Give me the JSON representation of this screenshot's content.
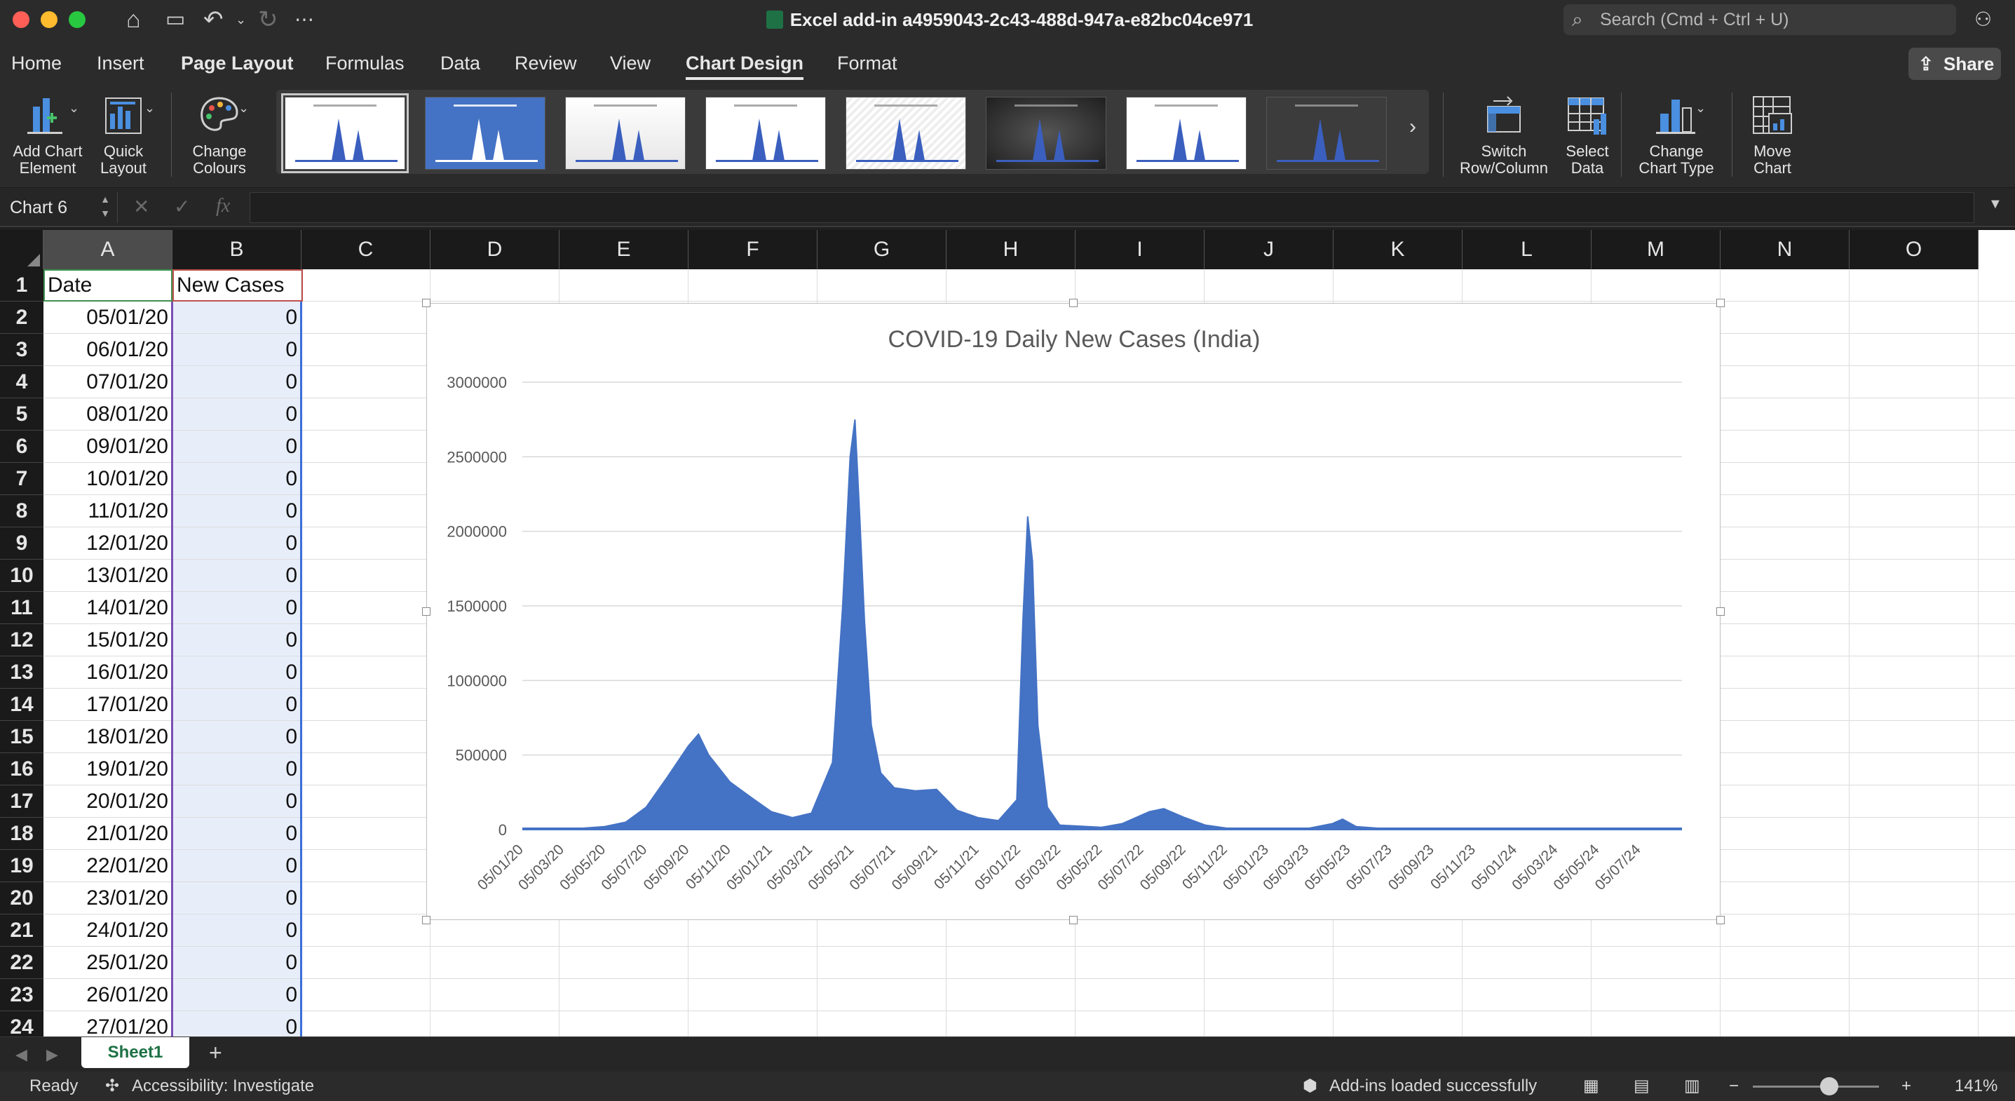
{
  "window": {
    "title": "Excel add-in a4959043-2c43-488d-947a-e82bc04ce971",
    "search_placeholder": "Search (Cmd + Ctrl + U)"
  },
  "menu": {
    "tabs": [
      "Home",
      "Insert",
      "Page Layout",
      "Formulas",
      "Data",
      "Review",
      "View",
      "Chart Design",
      "Format"
    ],
    "active": "Chart Design",
    "share_label": "Share"
  },
  "ribbon": {
    "add_chart_element": "Add Chart\nElement",
    "quick_layout": "Quick\nLayout",
    "change_colours": "Change\nColours",
    "switch_row_column": "Switch\nRow/Column",
    "select_data": "Select\nData",
    "change_chart_type": "Change\nChart Type",
    "move_chart": "Move\nChart"
  },
  "formula_bar": {
    "name_box": "Chart 6",
    "fx": "fx",
    "value": ""
  },
  "grid": {
    "columns": [
      "A",
      "B",
      "C",
      "D",
      "E",
      "F",
      "G",
      "H",
      "I",
      "J",
      "K",
      "L",
      "M",
      "N",
      "O"
    ],
    "selected_column": "A",
    "row_numbers": [
      "1",
      "2",
      "3",
      "4",
      "5",
      "6",
      "7",
      "8",
      "9",
      "10",
      "11",
      "12",
      "13",
      "14",
      "15",
      "16",
      "17",
      "18",
      "19",
      "20",
      "21",
      "22",
      "23",
      "24"
    ],
    "header": {
      "a1": "Date",
      "b1": "New Cases"
    },
    "rows": [
      [
        "05/01/20",
        "0"
      ],
      [
        "06/01/20",
        "0"
      ],
      [
        "07/01/20",
        "0"
      ],
      [
        "08/01/20",
        "0"
      ],
      [
        "09/01/20",
        "0"
      ],
      [
        "10/01/20",
        "0"
      ],
      [
        "11/01/20",
        "0"
      ],
      [
        "12/01/20",
        "0"
      ],
      [
        "13/01/20",
        "0"
      ],
      [
        "14/01/20",
        "0"
      ],
      [
        "15/01/20",
        "0"
      ],
      [
        "16/01/20",
        "0"
      ],
      [
        "17/01/20",
        "0"
      ],
      [
        "18/01/20",
        "0"
      ],
      [
        "19/01/20",
        "0"
      ],
      [
        "20/01/20",
        "0"
      ],
      [
        "21/01/20",
        "0"
      ],
      [
        "22/01/20",
        "0"
      ],
      [
        "23/01/20",
        "0"
      ],
      [
        "24/01/20",
        "0"
      ],
      [
        "25/01/20",
        "0"
      ],
      [
        "26/01/20",
        "0"
      ],
      [
        "27/01/20",
        "0"
      ]
    ]
  },
  "chart_data": {
    "type": "area",
    "title": "COVID-19 Daily New Cases (India)",
    "xlabel": "",
    "ylabel": "",
    "ylim": [
      0,
      3000000
    ],
    "yticks": [
      "0",
      "500000",
      "1000000",
      "1500000",
      "2000000",
      "2500000",
      "3000000"
    ],
    "xticks": [
      "05/01/20",
      "05/03/20",
      "05/05/20",
      "05/07/20",
      "05/09/20",
      "05/11/20",
      "05/01/21",
      "05/03/21",
      "05/05/21",
      "05/07/21",
      "05/09/21",
      "05/11/21",
      "05/01/22",
      "05/03/22",
      "05/05/22",
      "05/07/22",
      "05/09/22",
      "05/11/22",
      "05/01/23",
      "05/03/23",
      "05/05/23",
      "05/07/23",
      "05/09/23",
      "05/11/23",
      "05/01/24",
      "05/03/24",
      "05/05/24",
      "05/07/24"
    ],
    "series": [
      {
        "name": "New Cases",
        "color": "#4472c4",
        "x": [
          "05/01/20",
          "05/03/20",
          "05/05/20",
          "05/06/20",
          "05/07/20",
          "05/08/20",
          "05/09/20",
          "20/09/20",
          "05/10/20",
          "05/11/20",
          "05/12/20",
          "05/01/21",
          "05/02/21",
          "05/03/21",
          "05/04/21",
          "20/04/21",
          "01/05/21",
          "08/05/21",
          "15/05/21",
          "22/05/21",
          "01/06/21",
          "15/06/21",
          "05/07/21",
          "05/08/21",
          "05/09/21",
          "05/10/21",
          "05/11/21",
          "05/12/21",
          "01/01/22",
          "10/01/22",
          "17/01/22",
          "24/01/22",
          "01/02/22",
          "15/02/22",
          "05/03/22",
          "05/05/22",
          "05/06/22",
          "15/07/22",
          "05/08/22",
          "05/09/22",
          "05/10/22",
          "05/11/22",
          "05/01/23",
          "05/03/23",
          "10/04/23",
          "25/04/23",
          "15/05/23",
          "05/07/23",
          "05/09/23",
          "05/01/24",
          "05/03/24",
          "05/05/24",
          "05/08/24"
        ],
        "values": [
          0,
          0,
          20000,
          50000,
          150000,
          350000,
          560000,
          640000,
          500000,
          320000,
          220000,
          120000,
          80000,
          110000,
          450000,
          1500000,
          2500000,
          2750000,
          2100000,
          1400000,
          700000,
          380000,
          280000,
          260000,
          270000,
          130000,
          80000,
          60000,
          200000,
          1400000,
          2100000,
          1800000,
          700000,
          150000,
          30000,
          15000,
          40000,
          120000,
          140000,
          80000,
          30000,
          10000,
          5000,
          8000,
          40000,
          70000,
          20000,
          3000,
          1000,
          2000,
          1000,
          500,
          0
        ]
      }
    ]
  },
  "sheets": {
    "tabs": [
      "Sheet1"
    ],
    "active": "Sheet1"
  },
  "status": {
    "ready": "Ready",
    "accessibility": "Accessibility: Investigate",
    "addins": "Add-ins loaded successfully",
    "zoom": "141%"
  }
}
